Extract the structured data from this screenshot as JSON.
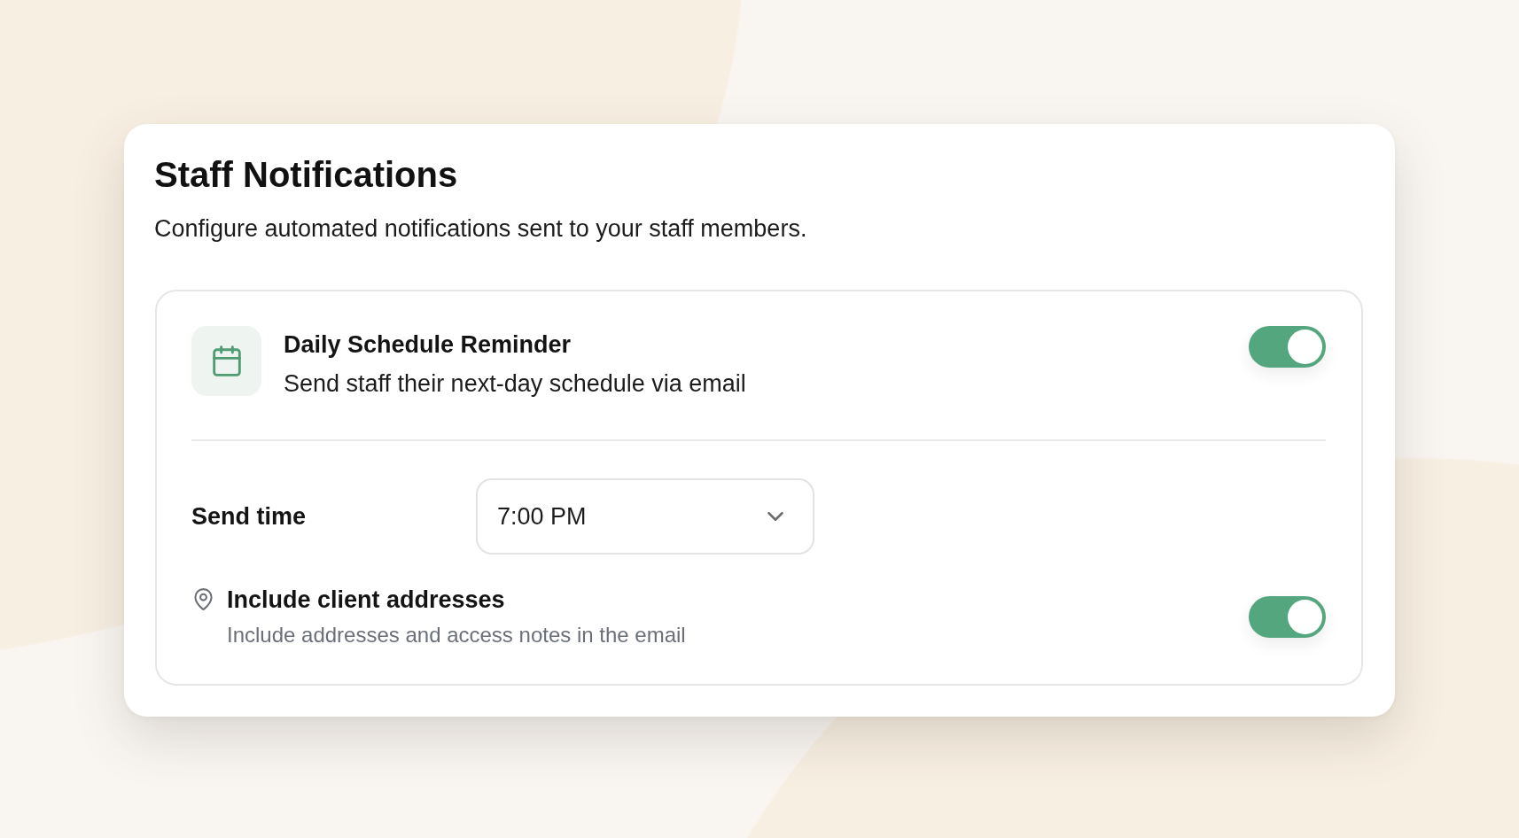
{
  "card": {
    "title": "Staff Notifications",
    "subtitle": "Configure automated notifications sent to your staff members."
  },
  "notification": {
    "title": "Daily Schedule Reminder",
    "description": "Send staff their next-day schedule via email",
    "on": true,
    "settings": [
      {
        "kind": "select",
        "label": "Send time",
        "value": "7:00 PM"
      },
      {
        "kind": "toggle",
        "label": "Include client addresses",
        "description": "Include addresses and access notes in the email",
        "on": true
      }
    ]
  }
}
